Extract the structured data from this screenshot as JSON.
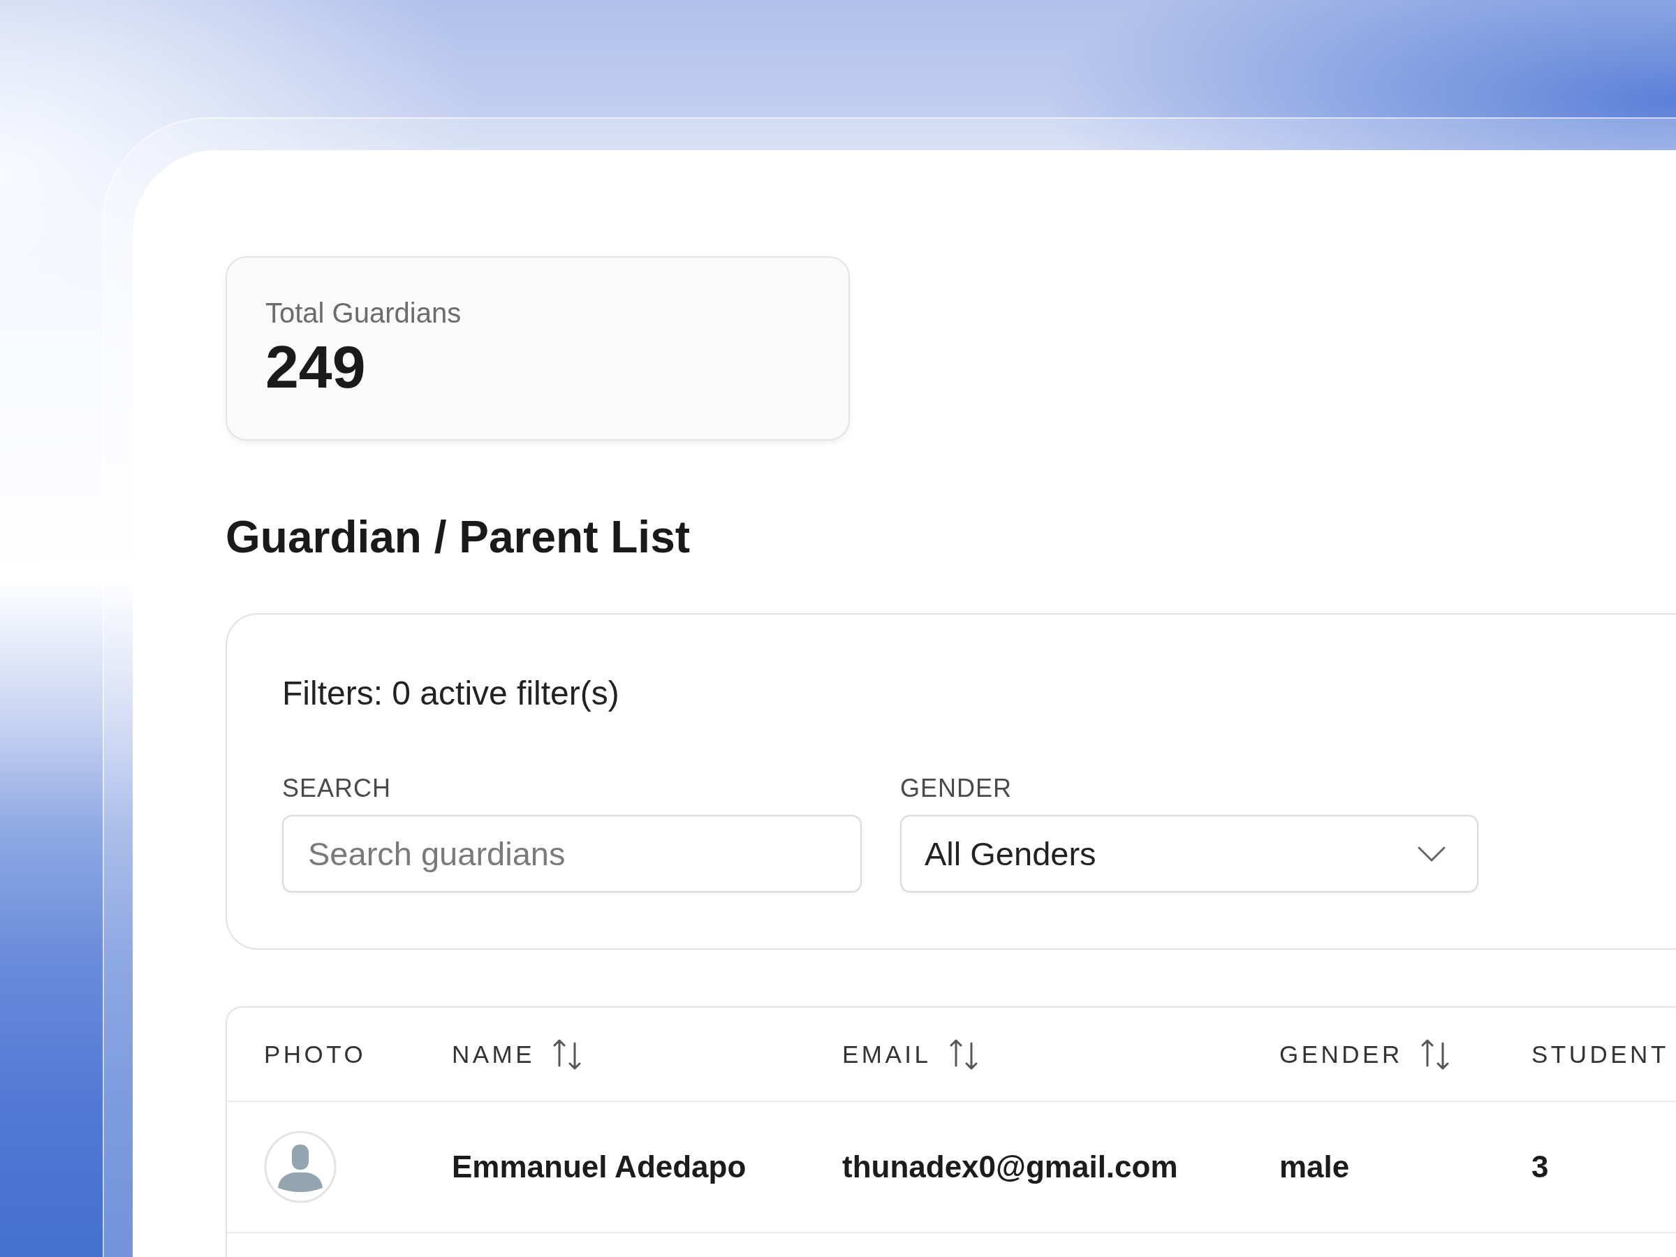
{
  "stat_card": {
    "label": "Total Guardians",
    "value": "249"
  },
  "page_title": "Guardian / Parent List",
  "filters": {
    "summary": "Filters: 0 active filter(s)",
    "fields": [
      {
        "kind": "search",
        "label": "SEARCH",
        "placeholder": "Search guardians"
      },
      {
        "kind": "select",
        "label": "GENDER",
        "value": "All Genders"
      }
    ]
  },
  "table": {
    "columns": [
      {
        "label": "PHOTO",
        "sortable": false
      },
      {
        "label": "NAME",
        "sortable": true
      },
      {
        "label": "EMAIL",
        "sortable": true
      },
      {
        "label": "GENDER",
        "sortable": true
      },
      {
        "label": "STUDENT",
        "sortable": false
      }
    ],
    "rows": [
      {
        "cells": [
          {
            "kind": "avatar"
          },
          {
            "kind": "text",
            "text": "Emmanuel Adedapo"
          },
          {
            "kind": "text",
            "text": "thunadex0@gmail.com"
          },
          {
            "kind": "text",
            "text": "male"
          },
          {
            "kind": "text",
            "text": "3"
          }
        ]
      }
    ]
  }
}
